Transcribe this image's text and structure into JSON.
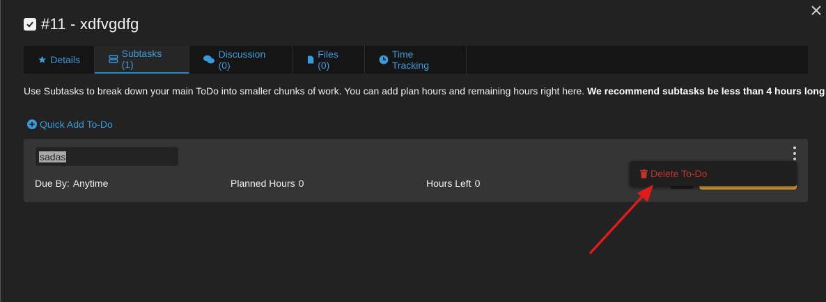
{
  "modal": {
    "close_glyph": "✕",
    "title": "#11 - xdfvgdfg"
  },
  "tabs": [
    {
      "label": "Details",
      "icon": "star-icon"
    },
    {
      "label": "Subtasks (1)",
      "icon": "server-icon"
    },
    {
      "label": "Discussion (0)",
      "icon": "comments-icon"
    },
    {
      "label": "Files (0)",
      "icon": "file-icon"
    },
    {
      "label": "Time Tracking",
      "icon": "clock-icon"
    }
  ],
  "intro": {
    "text": "Use Subtasks to break down your main ToDo into smaller chunks of work. You can add plan hours and remaining hours right here. ",
    "bold": "We recommend subtasks be less than 4 hours long",
    "end": "."
  },
  "quick_add": {
    "label": "Quick Add To-Do"
  },
  "subtask": {
    "name_value": "sadas",
    "due_label": "Due By:",
    "due_value": "Anytime",
    "planned_label": "Planned Hours",
    "planned_value": "0",
    "left_label": "Hours Left",
    "left_value": "0"
  },
  "menu": {
    "delete_label": "Delete To-Do"
  },
  "colors": {
    "accent": "#3a9ad9",
    "danger": "#c0342d",
    "warning": "#e8a93a",
    "annotation": "#e01b1b"
  }
}
